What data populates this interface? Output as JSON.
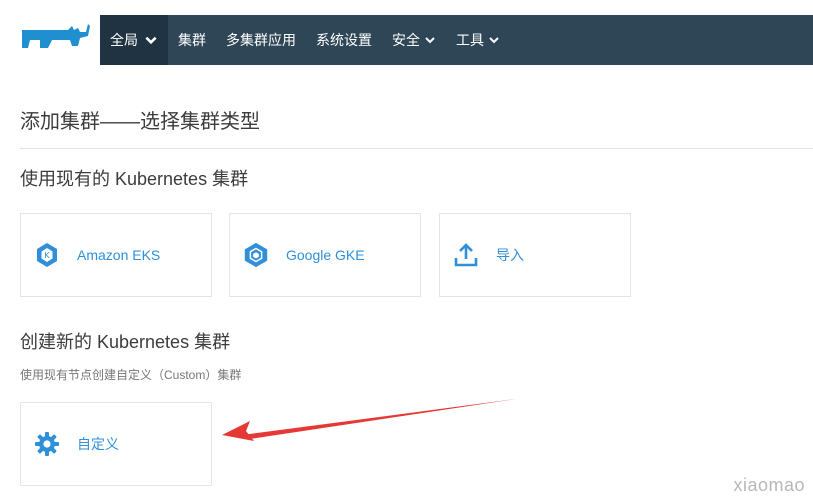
{
  "nav": {
    "items": [
      {
        "label": "全局",
        "dropdown": true,
        "active": true
      },
      {
        "label": "集群",
        "dropdown": false
      },
      {
        "label": "多集群应用",
        "dropdown": false
      },
      {
        "label": "系统设置",
        "dropdown": false
      },
      {
        "label": "安全",
        "dropdown": true
      },
      {
        "label": "工具",
        "dropdown": true
      }
    ]
  },
  "page": {
    "title": "添加集群——选择集群类型"
  },
  "existing_section": {
    "title": "使用现有的 Kubernetes 集群",
    "cards": [
      {
        "label": "Amazon EKS",
        "icon": "eks-icon"
      },
      {
        "label": "Google GKE",
        "icon": "gke-icon"
      },
      {
        "label": "导入",
        "icon": "upload-icon"
      }
    ]
  },
  "new_section": {
    "title": "创建新的 Kubernetes 集群",
    "subtitle": "使用现有节点创建自定义（Custom）集群",
    "cards": [
      {
        "label": "自定义",
        "icon": "gear-icon"
      }
    ]
  },
  "watermark": "xiaomao",
  "colors": {
    "nav_bg": "#2e4656",
    "nav_active": "#1f3342",
    "accent": "#2f8fd8",
    "logo": "#1f8fcf",
    "annotation_arrow": "#e53935"
  }
}
